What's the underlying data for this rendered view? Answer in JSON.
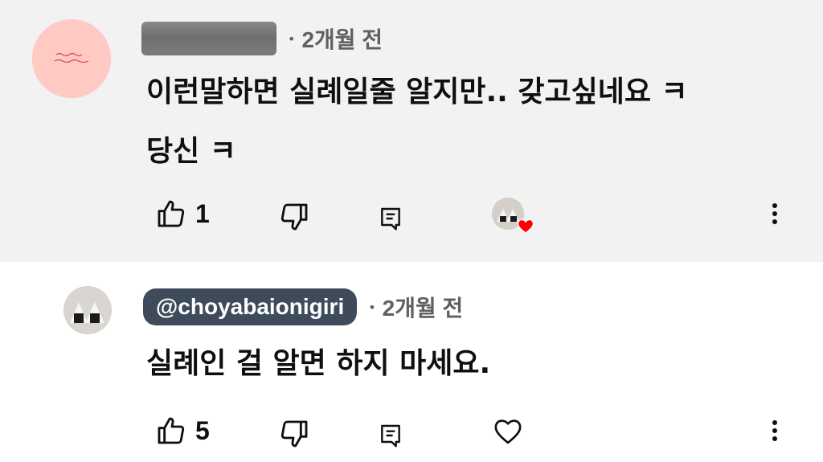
{
  "comments": [
    {
      "author": "",
      "time": "2개월 전",
      "text": "이런말하면 실례일줄 알지만.. 갖고싶네요 ㅋ\n당신 ㅋ",
      "likes": "1",
      "creator_heart": true,
      "avatar_icon": "pink-handwriting-avatar"
    },
    {
      "author": "@choyabaionigiri",
      "time": "2개월 전",
      "text": "실례인 걸 알면 하지 마세요.",
      "likes": "5",
      "creator_heart": false,
      "avatar_icon": "onigiri-avatar"
    }
  ],
  "separator": "•",
  "colors": {
    "highlight_bg": "#f2f2f2",
    "handle_bg": "#3e4b5b",
    "heart_red": "#ff0000",
    "muted_text": "#606060"
  }
}
